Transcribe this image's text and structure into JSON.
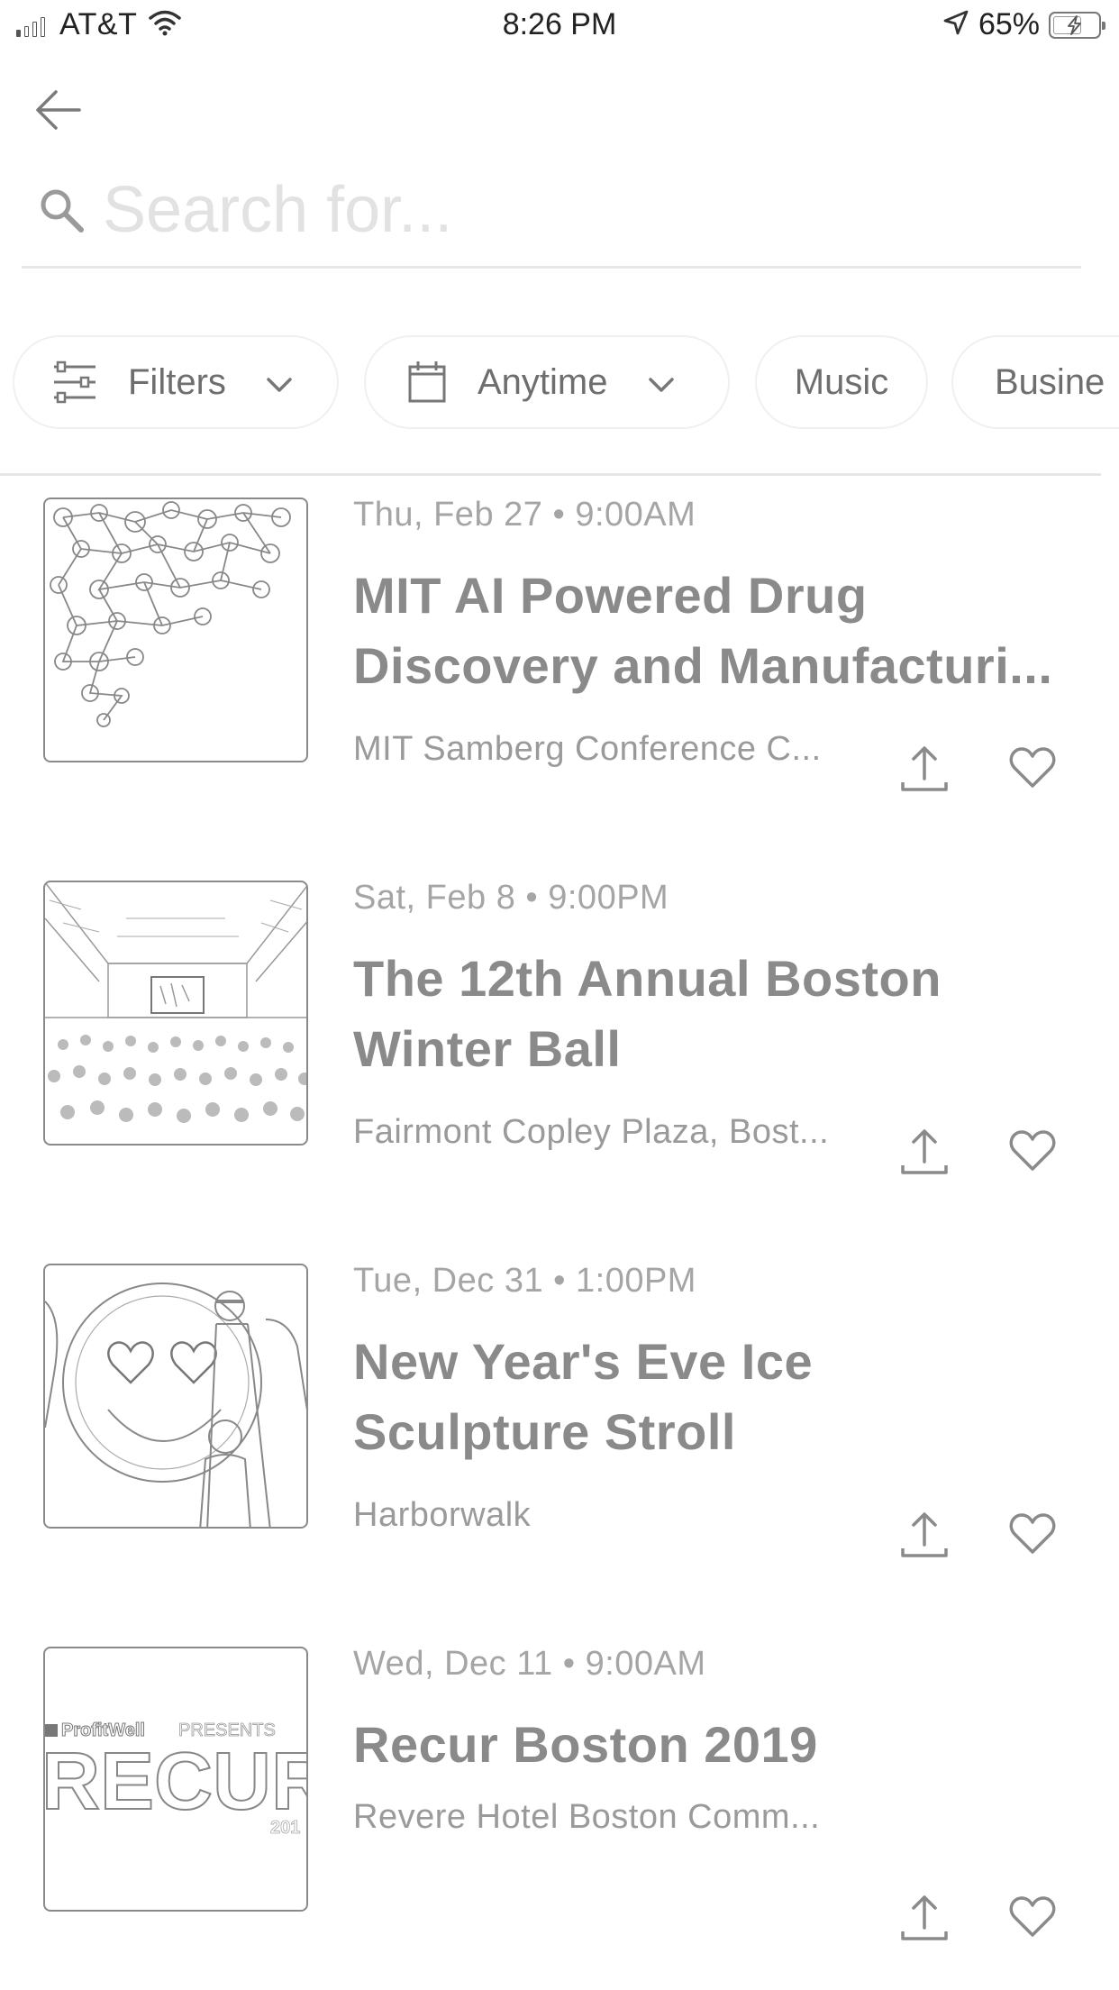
{
  "status_bar": {
    "carrier": "AT&T",
    "time": "8:26 PM",
    "battery": "65%",
    "battery_level": 0.65,
    "icons": [
      "signal-icon",
      "wifi-icon",
      "location-arrow-icon",
      "battery-charging-icon"
    ]
  },
  "header": {
    "back_icon": "arrow-left-icon",
    "search_icon": "search-icon",
    "search_placeholder": "Search for...",
    "search_value": ""
  },
  "chips": [
    {
      "label": "Filters",
      "icon": "sliders-icon",
      "has_dropdown": true
    },
    {
      "label": "Anytime",
      "icon": "calendar-icon",
      "has_dropdown": true
    },
    {
      "label": "Music"
    },
    {
      "label": "Busine"
    }
  ],
  "events": [
    {
      "date": "Thu, Feb 27 • 9:00AM",
      "title_line1": "MIT AI Powered Drug",
      "title_line2": "Discovery and Manufacturi...",
      "venue": "MIT Samberg Conference C...",
      "image": "molecule-network-image"
    },
    {
      "date": "Sat, Feb 8 • 9:00PM",
      "title_line1": "The 12th Annual Boston",
      "title_line2": "Winter Ball",
      "venue": "Fairmont Copley Plaza, Bost...",
      "image": "ballroom-crowd-image"
    },
    {
      "date": "Tue, Dec 31 • 1:00PM",
      "title_line1": "New Year's Eve Ice",
      "title_line2": "Sculpture Stroll",
      "venue": "Harborwalk",
      "image": "ice-sculpture-emoji-image"
    },
    {
      "date": "Wed, Dec 11 • 9:00AM",
      "title_line1": "Recur Boston 2019",
      "title_line2": "",
      "venue": "Revere Hotel Boston Comm...",
      "image": "recur-logo-image",
      "image_text": {
        "brand": "ProfitWell",
        "presents": "PRESENTS",
        "word": "RECUR",
        "year": "201"
      }
    }
  ],
  "actions": {
    "share_icon": "share-icon",
    "like_icon": "heart-icon"
  }
}
